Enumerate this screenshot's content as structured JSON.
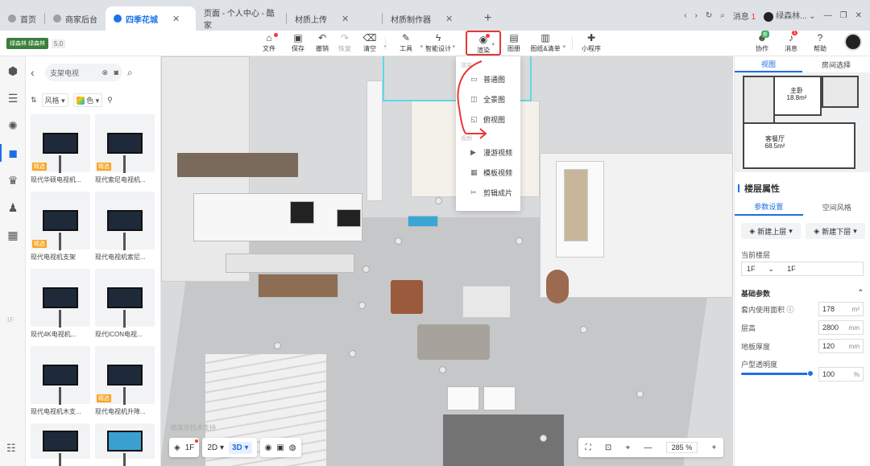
{
  "browser": {
    "tabs": [
      {
        "label": "首页"
      },
      {
        "label": "商家后台"
      },
      {
        "label": "四季花城",
        "active": true
      },
      {
        "label": "页面 - 个人中心 - 酷家"
      },
      {
        "label": "材质上传"
      },
      {
        "label": "材质制作器"
      }
    ],
    "new_tab": "+",
    "messages_label": "消息",
    "messages_count": "1",
    "user_name": "绿森林...",
    "window_controls": [
      "—",
      "❐",
      "✕"
    ]
  },
  "toolbar": {
    "brand": "绿森林 绿森林",
    "version": "5.0",
    "tools": [
      {
        "label": "文件"
      },
      {
        "label": "保存"
      },
      {
        "label": "撤销"
      },
      {
        "label": "恢复"
      },
      {
        "label": "清空"
      },
      {
        "label": "工具"
      },
      {
        "label": "智能设计"
      },
      {
        "label": "渲染"
      },
      {
        "label": "图册"
      },
      {
        "label": "图纸&清单"
      },
      {
        "label": "小程序"
      }
    ],
    "right": [
      {
        "label": "协作",
        "badge": "新"
      },
      {
        "label": "消息",
        "badge": "1"
      },
      {
        "label": "帮助"
      }
    ]
  },
  "rail": {
    "floor_label": "1F"
  },
  "catalog": {
    "search_value": "支架电视",
    "filters": {
      "style": "风格",
      "color": "色"
    },
    "items": [
      {
        "caption": "现代华硕电视机...",
        "tag": "精选"
      },
      {
        "caption": "现代索尼电视机...",
        "tag": "精选"
      },
      {
        "caption": "现代电视机支架",
        "tag": "精选"
      },
      {
        "caption": "现代电视机索尼...",
        "tag": ""
      },
      {
        "caption": "现代4K电视机...",
        "tag": ""
      },
      {
        "caption": "现代ICON电视...",
        "tag": ""
      },
      {
        "caption": "现代电视机木支...",
        "tag": ""
      },
      {
        "caption": "现代电视机升降...",
        "tag": "精选"
      }
    ]
  },
  "render_menu": {
    "section1": "渲染",
    "items1": [
      "普通图",
      "全景图",
      "俯视图"
    ],
    "section2": "视频",
    "items2": [
      "漫游视频",
      "模板视频",
      "剪辑成片"
    ]
  },
  "viewport": {
    "watermark": "酷家乐技术支持",
    "floor_button": "1F",
    "mode_2d": "2D",
    "mode_3d": "3D",
    "zoom_value": "285",
    "zoom_unit": "%"
  },
  "right_panel": {
    "tabs": [
      "视图",
      "房间选择"
    ],
    "minimap_rooms": [
      {
        "name": "主卧",
        "area": "18.8m²"
      },
      {
        "name": "客餐厅",
        "area": "68.5m²"
      }
    ],
    "section_title": "楼层属性",
    "subtabs": [
      "参数设置",
      "空间风格"
    ],
    "add_up": "新建上层",
    "add_down": "新建下层",
    "current_floor_label": "当前楼层",
    "current_floor_a": "1F",
    "current_floor_b": "1F",
    "basic_params_label": "基础参数",
    "params": [
      {
        "label": "套内使用面积",
        "value": "178",
        "unit": "m²"
      },
      {
        "label": "层高",
        "value": "2800",
        "unit": "mm"
      },
      {
        "label": "地板厚度",
        "value": "120",
        "unit": "mm"
      },
      {
        "label": "户型透明度",
        "value": "100",
        "unit": "%"
      }
    ],
    "transparency": 100
  },
  "colors": {
    "accent": "#1e6fe3",
    "highlight_red": "#e53935",
    "tag_orange": "#f5a623"
  }
}
